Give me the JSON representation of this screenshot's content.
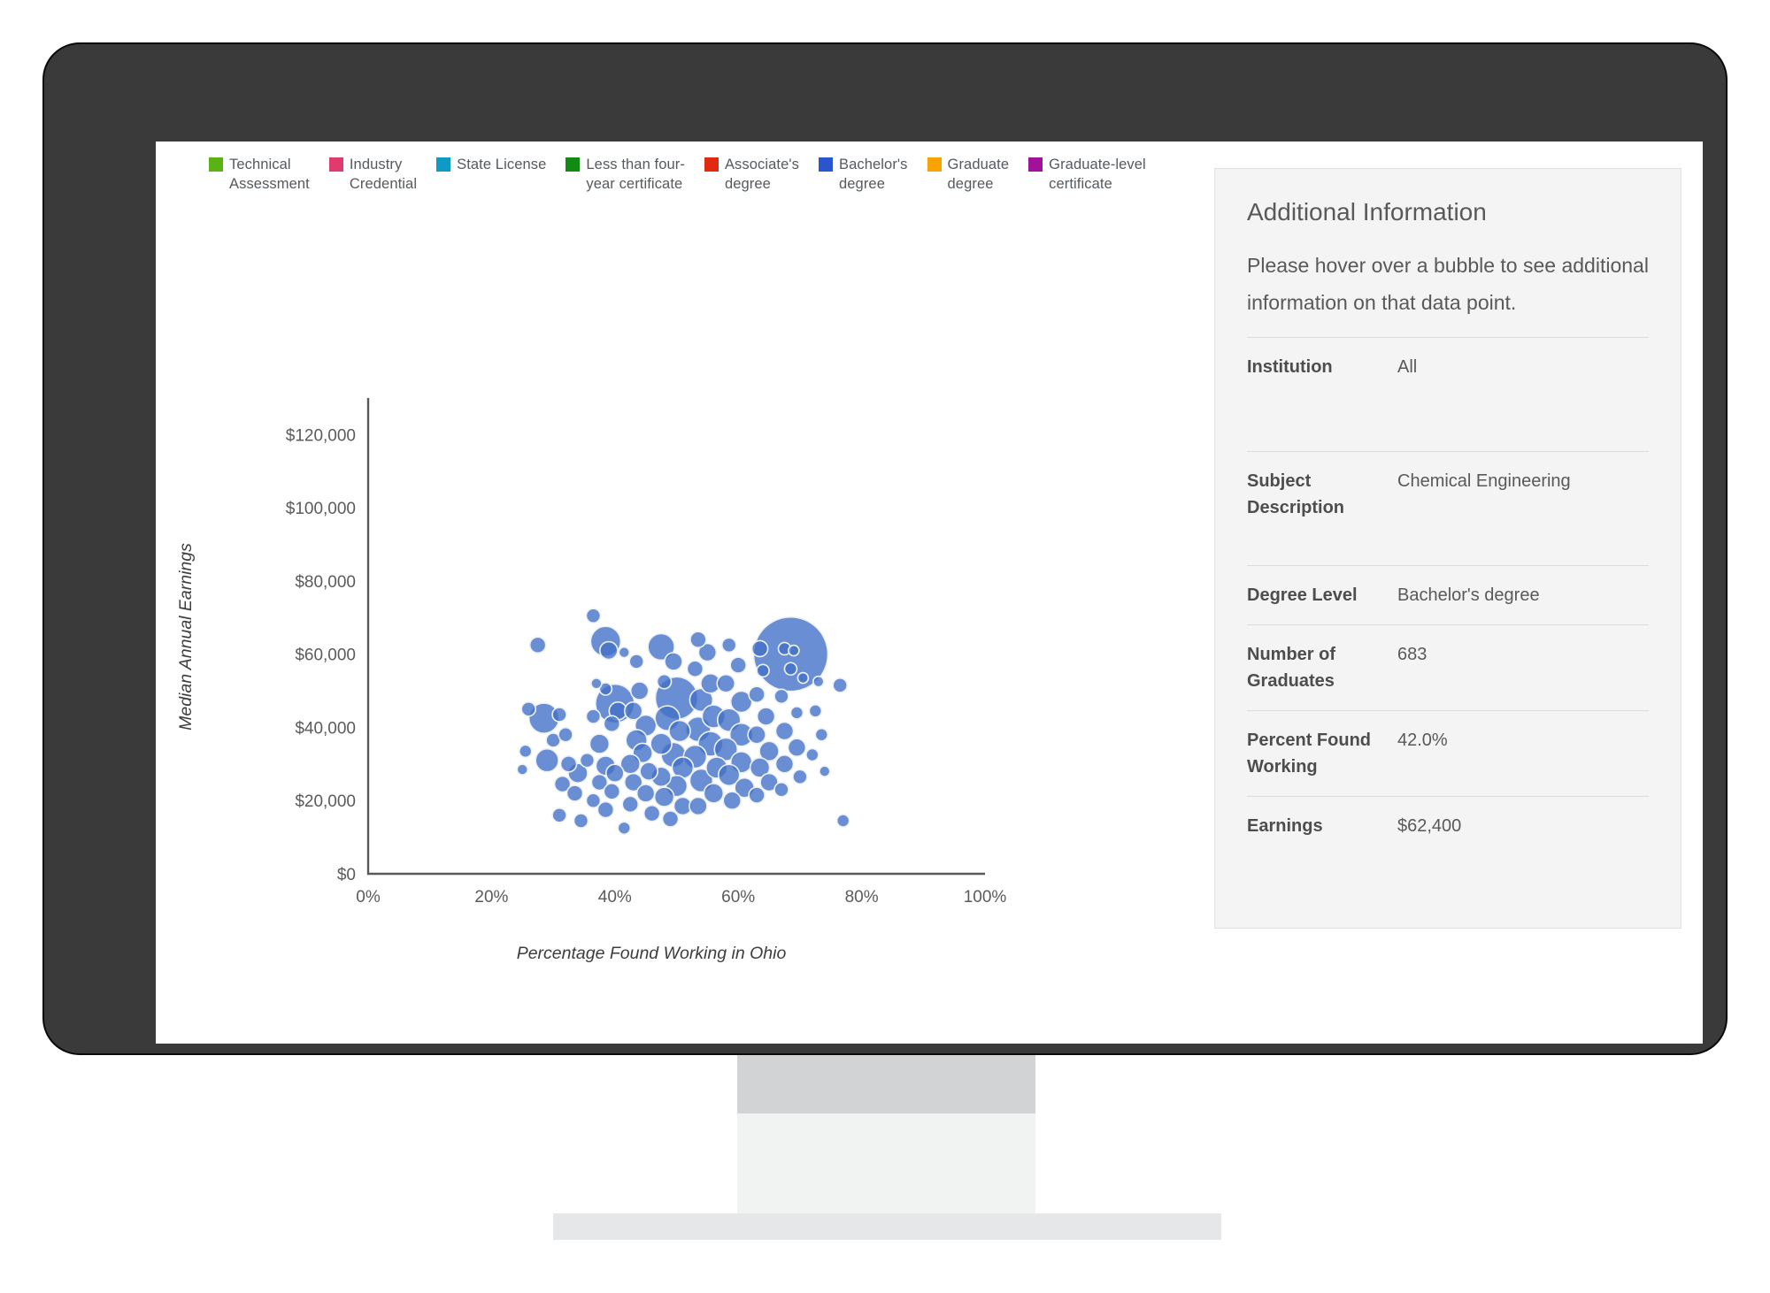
{
  "device": {
    "type": "desktop-monitor",
    "bezel_color": "#3a3a3a",
    "screen_color": "#ffffff",
    "stand_top_color": "#d1d3d4",
    "stand_bottom_color": "#f1f2f2",
    "stand_base_color": "#e6e7e8"
  },
  "legend": {
    "items": [
      {
        "label": "Technical\nAssessment",
        "color": "#58b313",
        "name": "technical-assessment"
      },
      {
        "label": "Industry\nCredential",
        "color": "#e03a6e",
        "name": "industry-credential"
      },
      {
        "label": "State License",
        "color": "#0e9ac4",
        "name": "state-license"
      },
      {
        "label": "Less than four-\nyear certificate",
        "color": "#128a13",
        "name": "less-than-four-year-certificate"
      },
      {
        "label": "Associate's\ndegree",
        "color": "#e02b12",
        "name": "associates-degree"
      },
      {
        "label": "Bachelor's\ndegree",
        "color": "#2b54d0",
        "name": "bachelors-degree"
      },
      {
        "label": "Graduate\ndegree",
        "color": "#f7a300",
        "name": "graduate-degree"
      },
      {
        "label": "Graduate-level\ncertificate",
        "color": "#a0129b",
        "name": "graduate-level-certificate"
      }
    ]
  },
  "info_panel": {
    "title": "Additional Information",
    "hint": "Please hover over a bubble to see additional information on that data point.",
    "rows": [
      {
        "key": "Institution",
        "value": "All",
        "tall": true
      },
      {
        "key": "Subject Description",
        "value": "Chemical Engineering",
        "tall": true
      },
      {
        "key": "Degree Level",
        "value": "Bachelor's degree",
        "tall": false
      },
      {
        "key": "Number of Graduates",
        "value": "683",
        "tall": false
      },
      {
        "key": "Percent Found Working",
        "value": "42.0%",
        "tall": false
      },
      {
        "key": "Earnings",
        "value": "$62,400",
        "tall": false
      }
    ]
  },
  "chart_data": {
    "type": "scatter",
    "title": "",
    "xlabel": "Percentage Found Working in Ohio",
    "ylabel": "Median Annual Earnings",
    "xlim": [
      0,
      100
    ],
    "ylim": [
      0,
      130000
    ],
    "grid": false,
    "legend_position": "top",
    "xticks": [
      "0%",
      "20%",
      "40%",
      "60%",
      "80%",
      "100%"
    ],
    "xtick_values": [
      0,
      20,
      40,
      60,
      80,
      100
    ],
    "yticks": [
      "$0",
      "$20,000",
      "$40,000",
      "$60,000",
      "$80,000",
      "$100,000",
      "$120,000"
    ],
    "ytick_values": [
      0,
      20000,
      40000,
      60000,
      80000,
      100000,
      120000
    ],
    "size_encoding": "Number of Graduates",
    "color_encoding": "Credential / Degree Level",
    "series": [
      {
        "name": "Bachelor's degree",
        "color": "#4472c8",
        "points": [
          {
            "x": 27.5,
            "y": 62500,
            "r": 9
          },
          {
            "x": 26.0,
            "y": 45000,
            "r": 8
          },
          {
            "x": 25.5,
            "y": 33500,
            "r": 7
          },
          {
            "x": 25.0,
            "y": 28500,
            "r": 6
          },
          {
            "x": 28.5,
            "y": 42500,
            "r": 17
          },
          {
            "x": 31.0,
            "y": 43500,
            "r": 8
          },
          {
            "x": 30.0,
            "y": 36500,
            "r": 8
          },
          {
            "x": 32.0,
            "y": 38000,
            "r": 8
          },
          {
            "x": 29.0,
            "y": 31000,
            "r": 13
          },
          {
            "x": 32.5,
            "y": 30000,
            "r": 9
          },
          {
            "x": 34.0,
            "y": 27500,
            "r": 11
          },
          {
            "x": 31.5,
            "y": 24500,
            "r": 9
          },
          {
            "x": 33.5,
            "y": 22000,
            "r": 9
          },
          {
            "x": 31.0,
            "y": 16000,
            "r": 8
          },
          {
            "x": 34.5,
            "y": 14500,
            "r": 8
          },
          {
            "x": 36.5,
            "y": 70500,
            "r": 8
          },
          {
            "x": 38.5,
            "y": 63500,
            "r": 17
          },
          {
            "x": 39.0,
            "y": 61000,
            "r": 10
          },
          {
            "x": 41.5,
            "y": 60500,
            "r": 6
          },
          {
            "x": 37.0,
            "y": 52000,
            "r": 6
          },
          {
            "x": 38.5,
            "y": 50500,
            "r": 7
          },
          {
            "x": 40.0,
            "y": 46500,
            "r": 22
          },
          {
            "x": 40.5,
            "y": 44500,
            "r": 10
          },
          {
            "x": 39.5,
            "y": 41000,
            "r": 9
          },
          {
            "x": 36.5,
            "y": 43000,
            "r": 8
          },
          {
            "x": 37.5,
            "y": 35500,
            "r": 11
          },
          {
            "x": 35.5,
            "y": 31000,
            "r": 8
          },
          {
            "x": 38.5,
            "y": 29500,
            "r": 11
          },
          {
            "x": 40.0,
            "y": 27500,
            "r": 10
          },
          {
            "x": 37.5,
            "y": 25000,
            "r": 9
          },
          {
            "x": 39.5,
            "y": 22500,
            "r": 9
          },
          {
            "x": 36.5,
            "y": 20000,
            "r": 8
          },
          {
            "x": 38.5,
            "y": 17500,
            "r": 9
          },
          {
            "x": 41.5,
            "y": 12500,
            "r": 7
          },
          {
            "x": 43.5,
            "y": 58000,
            "r": 8
          },
          {
            "x": 44.0,
            "y": 50000,
            "r": 10
          },
          {
            "x": 43.0,
            "y": 44500,
            "r": 10
          },
          {
            "x": 45.0,
            "y": 40500,
            "r": 12
          },
          {
            "x": 43.5,
            "y": 36500,
            "r": 12
          },
          {
            "x": 44.5,
            "y": 33000,
            "r": 11
          },
          {
            "x": 42.5,
            "y": 30000,
            "r": 11
          },
          {
            "x": 45.5,
            "y": 28000,
            "r": 10
          },
          {
            "x": 43.0,
            "y": 25000,
            "r": 10
          },
          {
            "x": 45.0,
            "y": 22000,
            "r": 10
          },
          {
            "x": 42.5,
            "y": 19000,
            "r": 9
          },
          {
            "x": 46.0,
            "y": 16500,
            "r": 9
          },
          {
            "x": 47.5,
            "y": 62000,
            "r": 15
          },
          {
            "x": 49.5,
            "y": 58000,
            "r": 10
          },
          {
            "x": 48.0,
            "y": 52500,
            "r": 8
          },
          {
            "x": 50.0,
            "y": 48000,
            "r": 24
          },
          {
            "x": 48.5,
            "y": 42500,
            "r": 14
          },
          {
            "x": 50.5,
            "y": 39000,
            "r": 12
          },
          {
            "x": 47.5,
            "y": 35500,
            "r": 12
          },
          {
            "x": 49.5,
            "y": 32500,
            "r": 14
          },
          {
            "x": 51.0,
            "y": 29000,
            "r": 12
          },
          {
            "x": 47.5,
            "y": 26500,
            "r": 11
          },
          {
            "x": 50.0,
            "y": 24000,
            "r": 12
          },
          {
            "x": 48.0,
            "y": 21000,
            "r": 11
          },
          {
            "x": 51.0,
            "y": 18500,
            "r": 10
          },
          {
            "x": 49.0,
            "y": 15000,
            "r": 9
          },
          {
            "x": 53.5,
            "y": 64000,
            "r": 9
          },
          {
            "x": 55.0,
            "y": 60500,
            "r": 10
          },
          {
            "x": 53.0,
            "y": 56000,
            "r": 9
          },
          {
            "x": 55.5,
            "y": 52000,
            "r": 11
          },
          {
            "x": 54.0,
            "y": 47500,
            "r": 13
          },
          {
            "x": 56.0,
            "y": 43000,
            "r": 13
          },
          {
            "x": 53.5,
            "y": 39500,
            "r": 14
          },
          {
            "x": 55.5,
            "y": 35500,
            "r": 14
          },
          {
            "x": 53.0,
            "y": 32000,
            "r": 13
          },
          {
            "x": 56.5,
            "y": 29000,
            "r": 12
          },
          {
            "x": 54.0,
            "y": 25500,
            "r": 13
          },
          {
            "x": 56.0,
            "y": 22000,
            "r": 11
          },
          {
            "x": 53.5,
            "y": 18500,
            "r": 10
          },
          {
            "x": 58.5,
            "y": 62500,
            "r": 8
          },
          {
            "x": 60.0,
            "y": 57000,
            "r": 9
          },
          {
            "x": 58.0,
            "y": 52000,
            "r": 10
          },
          {
            "x": 60.5,
            "y": 47000,
            "r": 12
          },
          {
            "x": 58.5,
            "y": 42000,
            "r": 13
          },
          {
            "x": 60.5,
            "y": 38000,
            "r": 13
          },
          {
            "x": 58.0,
            "y": 34000,
            "r": 13
          },
          {
            "x": 60.5,
            "y": 30500,
            "r": 12
          },
          {
            "x": 58.5,
            "y": 27000,
            "r": 12
          },
          {
            "x": 61.0,
            "y": 23500,
            "r": 11
          },
          {
            "x": 59.0,
            "y": 20000,
            "r": 10
          },
          {
            "x": 63.5,
            "y": 61500,
            "r": 9
          },
          {
            "x": 64.0,
            "y": 55500,
            "r": 7
          },
          {
            "x": 63.0,
            "y": 49000,
            "r": 9
          },
          {
            "x": 64.5,
            "y": 43000,
            "r": 10
          },
          {
            "x": 63.0,
            "y": 38000,
            "r": 10
          },
          {
            "x": 65.0,
            "y": 33500,
            "r": 11
          },
          {
            "x": 63.5,
            "y": 29000,
            "r": 11
          },
          {
            "x": 65.0,
            "y": 25000,
            "r": 10
          },
          {
            "x": 63.0,
            "y": 21500,
            "r": 9
          },
          {
            "x": 68.5,
            "y": 60000,
            "r": 42
          },
          {
            "x": 67.5,
            "y": 61500,
            "r": 7
          },
          {
            "x": 69.0,
            "y": 61000,
            "r": 6
          },
          {
            "x": 68.5,
            "y": 56000,
            "r": 7
          },
          {
            "x": 70.5,
            "y": 53500,
            "r": 6
          },
          {
            "x": 67.0,
            "y": 48500,
            "r": 8
          },
          {
            "x": 69.5,
            "y": 44000,
            "r": 7
          },
          {
            "x": 67.5,
            "y": 39000,
            "r": 10
          },
          {
            "x": 69.5,
            "y": 34500,
            "r": 10
          },
          {
            "x": 67.5,
            "y": 30000,
            "r": 10
          },
          {
            "x": 70.0,
            "y": 26500,
            "r": 8
          },
          {
            "x": 67.0,
            "y": 23000,
            "r": 8
          },
          {
            "x": 73.0,
            "y": 52500,
            "r": 6
          },
          {
            "x": 72.5,
            "y": 44500,
            "r": 7
          },
          {
            "x": 73.5,
            "y": 38000,
            "r": 7
          },
          {
            "x": 72.0,
            "y": 32500,
            "r": 7
          },
          {
            "x": 74.0,
            "y": 28000,
            "r": 6
          },
          {
            "x": 76.5,
            "y": 51500,
            "r": 8
          },
          {
            "x": 77.0,
            "y": 14500,
            "r": 7
          }
        ]
      }
    ],
    "highlighted_point": {
      "subject": "Chemical Engineering",
      "degree_level": "Bachelor's degree",
      "graduates": 683,
      "percent_working": 42.0,
      "earnings": 62400
    }
  }
}
